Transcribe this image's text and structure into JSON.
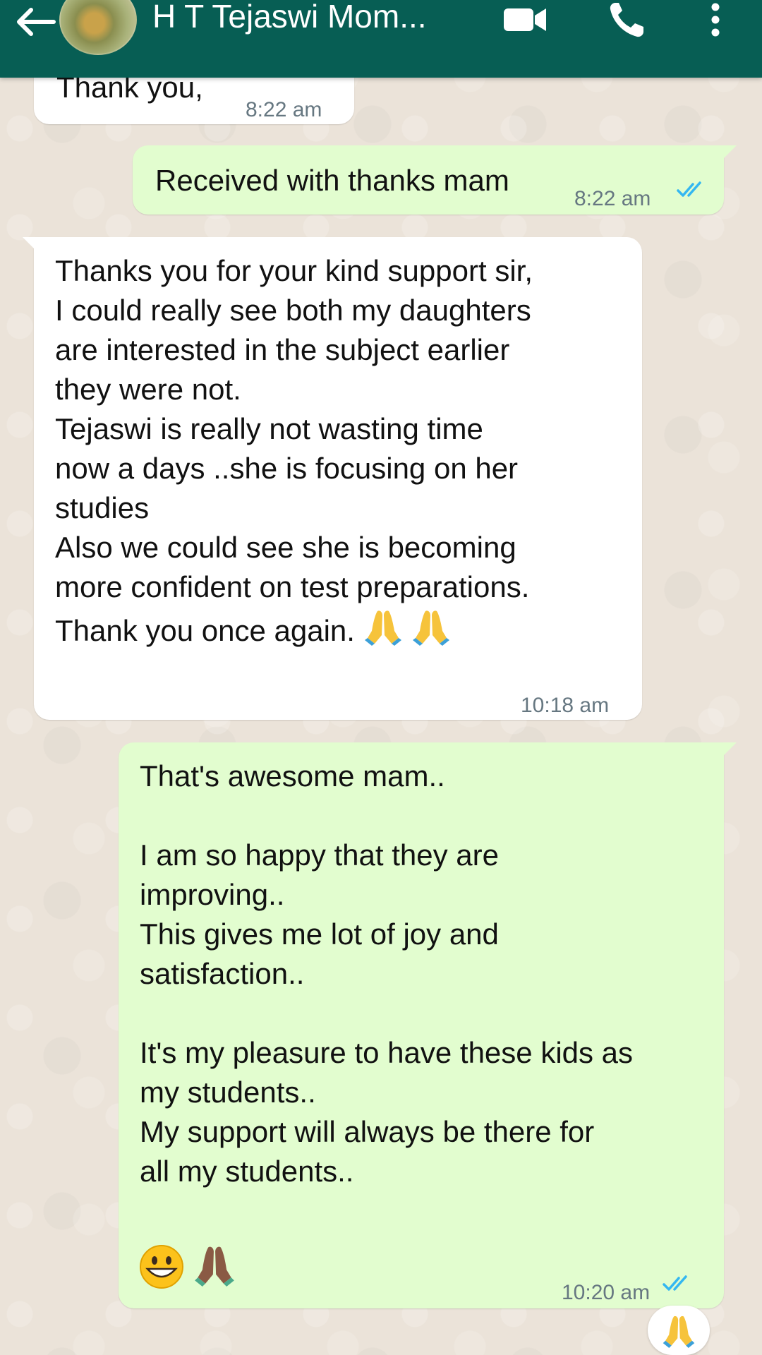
{
  "header": {
    "title": "H T Tejaswi Mom...",
    "back_icon": "arrow-left-icon",
    "video_icon": "video-call-icon",
    "call_icon": "phone-icon",
    "menu_icon": "more-vert-icon",
    "bar_color": "#075e54"
  },
  "messages": [
    {
      "direction": "incoming",
      "text": "Thank you,",
      "time": "8:22 am"
    },
    {
      "direction": "outgoing",
      "text": "Received with thanks mam",
      "time": "8:22 am",
      "status": "read",
      "status_icon": "double-check-icon"
    },
    {
      "direction": "incoming",
      "text": "Thanks you for your kind support sir,\nI could really see both my daughters\nare interested in the subject earlier\nthey were not.\nTejaswi is really not wasting time\nnow a days ..she is focusing on her\nstudies\nAlso we could see she is becoming\nmore confident on test preparations.\nThank you once again.",
      "emojis": [
        "folded-hands",
        "folded-hands"
      ],
      "time": "10:18 am"
    },
    {
      "direction": "outgoing",
      "text": "That's awesome mam..\n\nI am so happy that they are\nimproving..\nThis gives me lot of joy and\nsatisfaction..\n\nIt's my pleasure to have these kids as\nmy students..\nMy support will always be there for\nall my students..",
      "emojis": [
        "grinning-face",
        "folded-hands-dark"
      ],
      "time": "10:20 am",
      "status": "read",
      "status_icon": "double-check-icon"
    }
  ],
  "reaction": {
    "emoji": "folded-hands"
  },
  "colors": {
    "incoming_bubble": "#ffffff",
    "outgoing_bubble": "#e2fdcf",
    "read_tick": "#34b7f1",
    "timestamp": "#667781"
  }
}
